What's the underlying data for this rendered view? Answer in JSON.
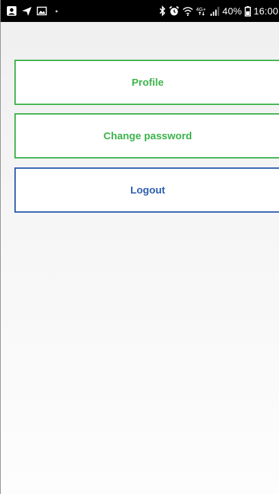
{
  "status_bar": {
    "left_icons": [
      "contact-icon",
      "send-icon",
      "image-icon",
      "dot-icon"
    ],
    "right_icons": [
      "bluetooth-icon",
      "alarm-icon",
      "wifi-icon",
      "network-4g-icon",
      "signal-icon",
      "battery-icon"
    ],
    "network_label": "4G+",
    "battery_percent": "40%",
    "time": "16:00"
  },
  "menu": {
    "profile_label": "Profile",
    "change_password_label": "Change password",
    "logout_label": "Logout"
  },
  "colors": {
    "primary_green": "#3cb44b",
    "logout_blue": "#2e5fad",
    "status_bar_bg": "#000000"
  }
}
